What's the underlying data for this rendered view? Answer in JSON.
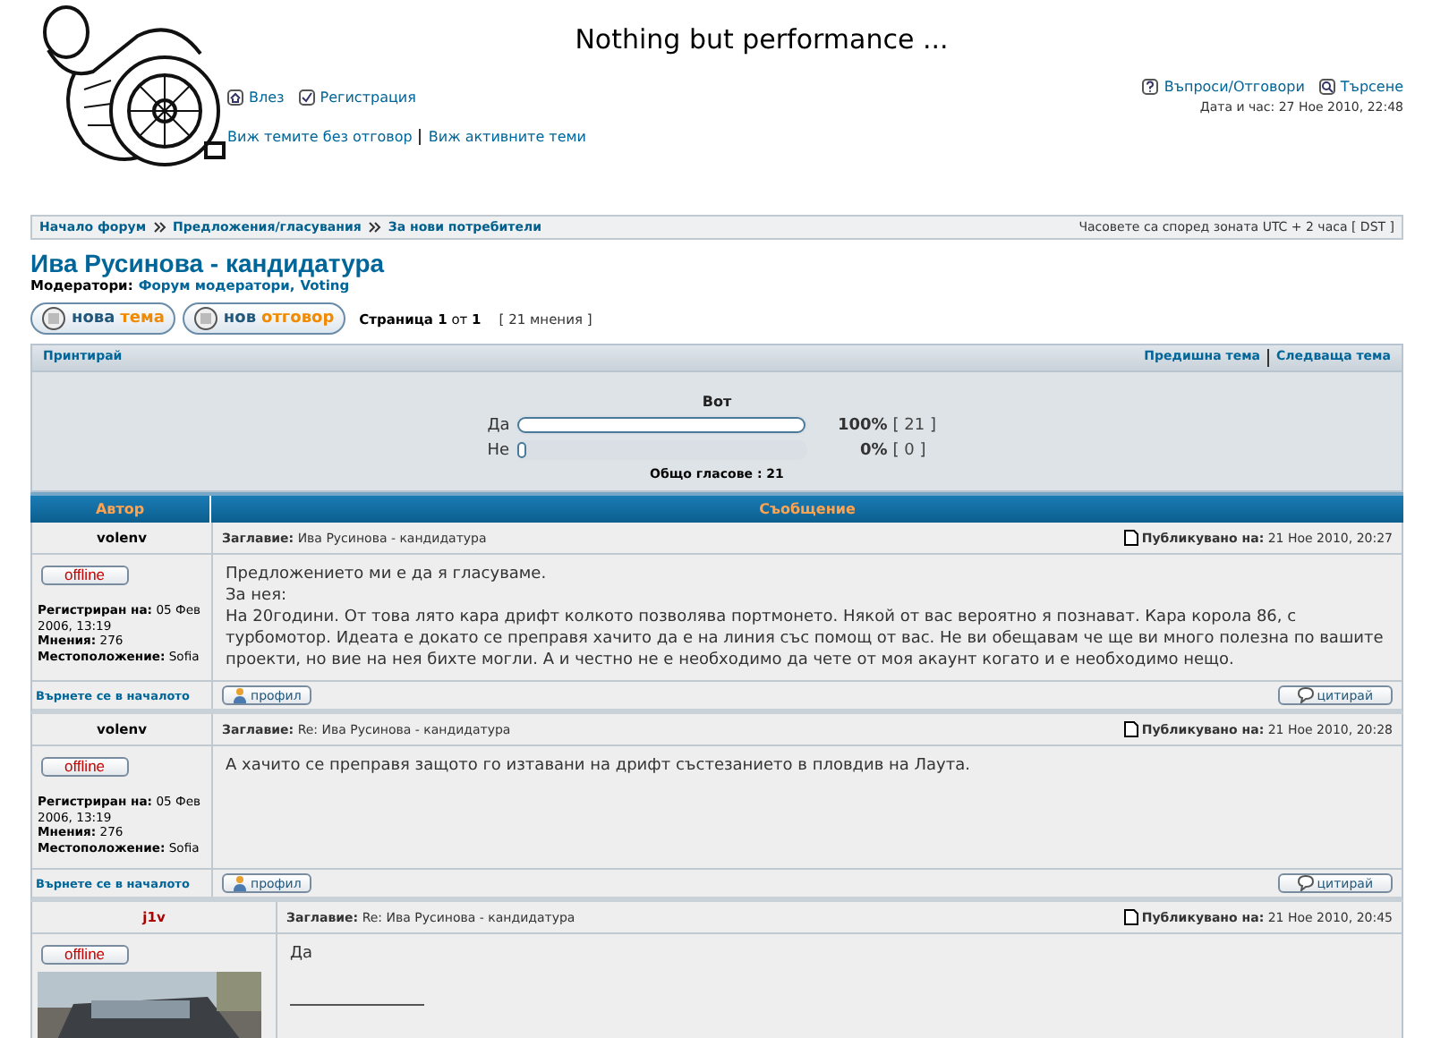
{
  "header": {
    "title": "Nothing but performance ...",
    "user_links": [
      "Влез",
      "Регистрация"
    ],
    "right_links": [
      "Въпроси/Отговори",
      "Търсене"
    ],
    "datetime": "Дата и час: 27 Ное 2010, 22:48",
    "topic_links": [
      "Виж темите без отговор",
      "Виж активните теми"
    ]
  },
  "breadcrumb": [
    "Начало форум",
    "Предложения/гласувания",
    "За нови потребители"
  ],
  "timezone": "Часовете са според зоната UTC + 2 часа [ DST ]",
  "topic": {
    "title": "Ива Русинова - кандидатура",
    "moderators_label": "Модератори:",
    "moderators": [
      "Форум модератори,",
      "Voting"
    ]
  },
  "buttons": [
    {
      "first": "нова",
      "second": "тема"
    },
    {
      "first": "нов",
      "second": "отговор"
    }
  ],
  "pagination": {
    "label": "Страница",
    "current": "1",
    "of": "от",
    "total": "1",
    "count": "[ 21 мнения ]"
  },
  "toolbar": {
    "print": "Принтирай",
    "prev": "Предишна тема",
    "next": "Следваща тема"
  },
  "poll": {
    "question": "Вот",
    "options": [
      {
        "label": "Да",
        "level": 1,
        "percent": "100%",
        "count": "[ 21 ]"
      },
      {
        "label": "Не",
        "level": 0,
        "percent": "0%",
        "count": "[ 0 ]"
      }
    ],
    "total": "Общо гласове : 21"
  },
  "columns": [
    "Автор",
    "Съобщение"
  ],
  "posts": [
    {
      "author": "volenv",
      "color": "#000000",
      "subject_label": "Заглавие:",
      "subject": "Ива Русинова - кандидатура",
      "posted_label": "Публикувано на:",
      "posted": "21 Ное 2010, 20:27",
      "status": "offline",
      "info": [
        {
          "label": "Регистриран на:",
          "value": "05 Фев 2006, 13:19"
        },
        {
          "label": "Мнения:",
          "value": "276"
        },
        {
          "label": "Местоположение:",
          "value": "Sofia"
        }
      ],
      "lines": [
        "Предложението ми е да я гласуваме.",
        "За нея:",
        "На 20години. От това лято кара дрифт колкото позволява портмонето. Някой от вас вероятно я познават. Кара корола 86, с турбомотор. Идеата е докато се преправя хачито да е на линия със помощ от вас. Не ви обещавам че ще ви много полезна по вашите проекти, но вие на нея бихте могли. А и честно не е необходимо да чете от моя акаунт когато и е необходимо нещо."
      ],
      "signature": false,
      "back": "Върнете се в началото",
      "profile": "профил",
      "quote": "цитирай"
    },
    {
      "author": "volenv",
      "color": "#000000",
      "subject_label": "Заглавие:",
      "subject": "Re: Ива Русинова - кандидатура",
      "posted_label": "Публикувано на:",
      "posted": "21 Ное 2010, 20:28",
      "status": "offline",
      "info": [
        {
          "label": "Регистриран на:",
          "value": "05 Фев 2006, 13:19"
        },
        {
          "label": "Мнения:",
          "value": "276"
        },
        {
          "label": "Местоположение:",
          "value": "Sofia"
        }
      ],
      "lines": [
        "А хачито се преправя защото го изтавани на дрифт състезанието в пловдив на Лаута."
      ],
      "signature": false,
      "back": "Върнете се в началото",
      "profile": "профил",
      "quote": "цитирай"
    },
    {
      "author": "j1v",
      "color": "#aa0000",
      "subject_label": "Заглавие:",
      "subject": "Re: Ива Русинова - кандидатура",
      "posted_label": "Публикувано на:",
      "posted": "21 Ное 2010, 20:45",
      "status": "offline",
      "avatar": {
        "kind": "picture"
      },
      "lines": [
        "Да"
      ],
      "signature": true
    }
  ]
}
